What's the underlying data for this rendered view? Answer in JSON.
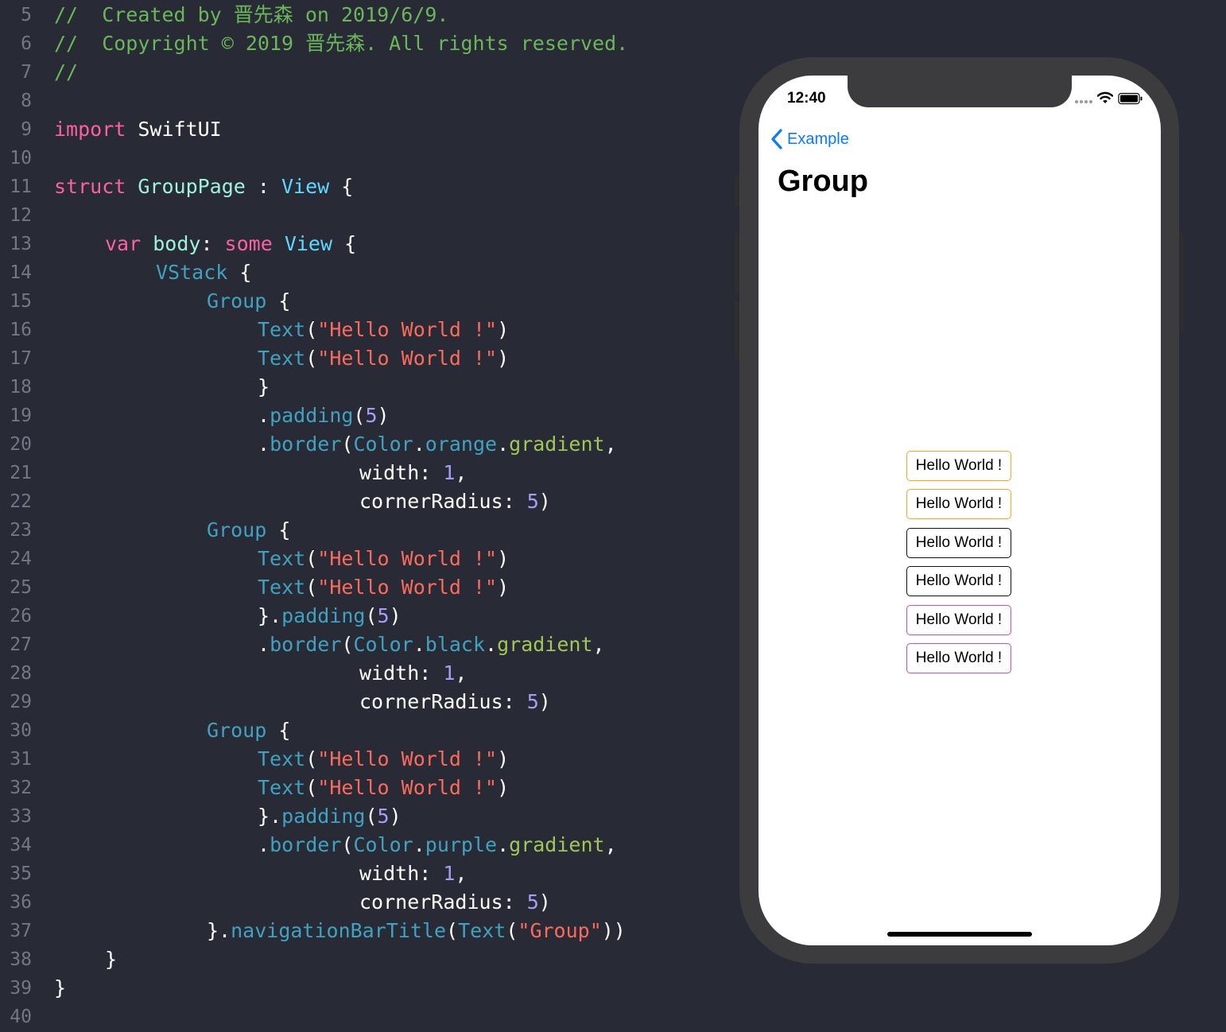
{
  "editor": {
    "lines": [
      {
        "num": "5",
        "indent": 0,
        "tokens": [
          {
            "t": "//  Created by 晋先森 on 2019/6/9.",
            "c": "com"
          }
        ]
      },
      {
        "num": "6",
        "indent": 0,
        "tokens": [
          {
            "t": "//  Copyright © 2019 晋先森. All rights reserved.",
            "c": "com"
          }
        ]
      },
      {
        "num": "7",
        "indent": 0,
        "tokens": [
          {
            "t": "//",
            "c": "com"
          }
        ]
      },
      {
        "num": "8",
        "indent": 0,
        "tokens": []
      },
      {
        "num": "9",
        "indent": 0,
        "tokens": [
          {
            "t": "import",
            "c": "kw"
          },
          {
            "t": " SwiftUI",
            "c": "plain"
          }
        ]
      },
      {
        "num": "10",
        "indent": 0,
        "tokens": []
      },
      {
        "num": "11",
        "indent": 0,
        "tokens": [
          {
            "t": "struct",
            "c": "kw"
          },
          {
            "t": " ",
            "c": "plain"
          },
          {
            "t": "GroupPage",
            "c": "custom"
          },
          {
            "t": " : ",
            "c": "plain"
          },
          {
            "t": "View",
            "c": "type"
          },
          {
            "t": " {",
            "c": "plain"
          }
        ]
      },
      {
        "num": "12",
        "indent": 0,
        "tokens": []
      },
      {
        "num": "13",
        "indent": 4,
        "tokens": [
          {
            "t": "var",
            "c": "kw"
          },
          {
            "t": " ",
            "c": "plain"
          },
          {
            "t": "body",
            "c": "custom"
          },
          {
            "t": ": ",
            "c": "plain"
          },
          {
            "t": "some",
            "c": "kw"
          },
          {
            "t": " ",
            "c": "plain"
          },
          {
            "t": "View",
            "c": "type"
          },
          {
            "t": " {",
            "c": "plain"
          }
        ]
      },
      {
        "num": "14",
        "indent": 8,
        "tokens": [
          {
            "t": "VStack",
            "c": "tp2"
          },
          {
            "t": " {",
            "c": "plain"
          }
        ]
      },
      {
        "num": "15",
        "indent": 12,
        "tokens": [
          {
            "t": "Group",
            "c": "tp2"
          },
          {
            "t": " {",
            "c": "plain"
          }
        ]
      },
      {
        "num": "16",
        "indent": 16,
        "tokens": [
          {
            "t": "Text",
            "c": "tp2"
          },
          {
            "t": "(",
            "c": "plain"
          },
          {
            "t": "\"Hello World !\"",
            "c": "str"
          },
          {
            "t": ")",
            "c": "plain"
          }
        ]
      },
      {
        "num": "17",
        "indent": 16,
        "tokens": [
          {
            "t": "Text",
            "c": "tp2"
          },
          {
            "t": "(",
            "c": "plain"
          },
          {
            "t": "\"Hello World !\"",
            "c": "str"
          },
          {
            "t": ")",
            "c": "plain"
          }
        ]
      },
      {
        "num": "18",
        "indent": 16,
        "tokens": [
          {
            "t": "}",
            "c": "plain"
          }
        ]
      },
      {
        "num": "19",
        "indent": 16,
        "tokens": [
          {
            "t": ".",
            "c": "plain"
          },
          {
            "t": "padding",
            "c": "mem"
          },
          {
            "t": "(",
            "c": "plain"
          },
          {
            "t": "5",
            "c": "num"
          },
          {
            "t": ")",
            "c": "plain"
          }
        ]
      },
      {
        "num": "20",
        "indent": 16,
        "tokens": [
          {
            "t": ".",
            "c": "plain"
          },
          {
            "t": "border",
            "c": "mem"
          },
          {
            "t": "(",
            "c": "plain"
          },
          {
            "t": "Color",
            "c": "tp2"
          },
          {
            "t": ".",
            "c": "plain"
          },
          {
            "t": "orange",
            "c": "mem"
          },
          {
            "t": ".",
            "c": "plain"
          },
          {
            "t": "gradient",
            "c": "prop"
          },
          {
            "t": ",",
            "c": "plain"
          }
        ]
      },
      {
        "num": "21",
        "indent": 24,
        "tokens": [
          {
            "t": "width: ",
            "c": "plain"
          },
          {
            "t": "1",
            "c": "num"
          },
          {
            "t": ",",
            "c": "plain"
          }
        ]
      },
      {
        "num": "22",
        "indent": 24,
        "tokens": [
          {
            "t": "cornerRadius: ",
            "c": "plain"
          },
          {
            "t": "5",
            "c": "num"
          },
          {
            "t": ")",
            "c": "plain"
          }
        ]
      },
      {
        "num": "23",
        "indent": 12,
        "tokens": [
          {
            "t": "Group",
            "c": "tp2"
          },
          {
            "t": " {",
            "c": "plain"
          }
        ]
      },
      {
        "num": "24",
        "indent": 16,
        "tokens": [
          {
            "t": "Text",
            "c": "tp2"
          },
          {
            "t": "(",
            "c": "plain"
          },
          {
            "t": "\"Hello World !\"",
            "c": "str"
          },
          {
            "t": ")",
            "c": "plain"
          }
        ]
      },
      {
        "num": "25",
        "indent": 16,
        "tokens": [
          {
            "t": "Text",
            "c": "tp2"
          },
          {
            "t": "(",
            "c": "plain"
          },
          {
            "t": "\"Hello World !\"",
            "c": "str"
          },
          {
            "t": ")",
            "c": "plain"
          }
        ]
      },
      {
        "num": "26",
        "indent": 16,
        "tokens": [
          {
            "t": "}.",
            "c": "plain"
          },
          {
            "t": "padding",
            "c": "mem"
          },
          {
            "t": "(",
            "c": "plain"
          },
          {
            "t": "5",
            "c": "num"
          },
          {
            "t": ")",
            "c": "plain"
          }
        ]
      },
      {
        "num": "27",
        "indent": 16,
        "tokens": [
          {
            "t": ".",
            "c": "plain"
          },
          {
            "t": "border",
            "c": "mem"
          },
          {
            "t": "(",
            "c": "plain"
          },
          {
            "t": "Color",
            "c": "tp2"
          },
          {
            "t": ".",
            "c": "plain"
          },
          {
            "t": "black",
            "c": "mem"
          },
          {
            "t": ".",
            "c": "plain"
          },
          {
            "t": "gradient",
            "c": "prop"
          },
          {
            "t": ",",
            "c": "plain"
          }
        ]
      },
      {
        "num": "28",
        "indent": 24,
        "tokens": [
          {
            "t": "width: ",
            "c": "plain"
          },
          {
            "t": "1",
            "c": "num"
          },
          {
            "t": ",",
            "c": "plain"
          }
        ]
      },
      {
        "num": "29",
        "indent": 24,
        "tokens": [
          {
            "t": "cornerRadius: ",
            "c": "plain"
          },
          {
            "t": "5",
            "c": "num"
          },
          {
            "t": ")",
            "c": "plain"
          }
        ]
      },
      {
        "num": "30",
        "indent": 12,
        "tokens": [
          {
            "t": "Group",
            "c": "tp2"
          },
          {
            "t": " {",
            "c": "plain"
          }
        ]
      },
      {
        "num": "31",
        "indent": 16,
        "tokens": [
          {
            "t": "Text",
            "c": "tp2"
          },
          {
            "t": "(",
            "c": "plain"
          },
          {
            "t": "\"Hello World !\"",
            "c": "str"
          },
          {
            "t": ")",
            "c": "plain"
          }
        ]
      },
      {
        "num": "32",
        "indent": 16,
        "tokens": [
          {
            "t": "Text",
            "c": "tp2"
          },
          {
            "t": "(",
            "c": "plain"
          },
          {
            "t": "\"Hello World !\"",
            "c": "str"
          },
          {
            "t": ")",
            "c": "plain"
          }
        ]
      },
      {
        "num": "33",
        "indent": 16,
        "tokens": [
          {
            "t": "}.",
            "c": "plain"
          },
          {
            "t": "padding",
            "c": "mem"
          },
          {
            "t": "(",
            "c": "plain"
          },
          {
            "t": "5",
            "c": "num"
          },
          {
            "t": ")",
            "c": "plain"
          }
        ]
      },
      {
        "num": "34",
        "indent": 16,
        "tokens": [
          {
            "t": ".",
            "c": "plain"
          },
          {
            "t": "border",
            "c": "mem"
          },
          {
            "t": "(",
            "c": "plain"
          },
          {
            "t": "Color",
            "c": "tp2"
          },
          {
            "t": ".",
            "c": "plain"
          },
          {
            "t": "purple",
            "c": "mem"
          },
          {
            "t": ".",
            "c": "plain"
          },
          {
            "t": "gradient",
            "c": "prop"
          },
          {
            "t": ",",
            "c": "plain"
          }
        ]
      },
      {
        "num": "35",
        "indent": 24,
        "tokens": [
          {
            "t": "width: ",
            "c": "plain"
          },
          {
            "t": "1",
            "c": "num"
          },
          {
            "t": ",",
            "c": "plain"
          }
        ]
      },
      {
        "num": "36",
        "indent": 24,
        "tokens": [
          {
            "t": "cornerRadius: ",
            "c": "plain"
          },
          {
            "t": "5",
            "c": "num"
          },
          {
            "t": ")",
            "c": "plain"
          }
        ]
      },
      {
        "num": "37",
        "indent": 12,
        "tokens": [
          {
            "t": "}.",
            "c": "plain"
          },
          {
            "t": "navigationBarTitle",
            "c": "mem"
          },
          {
            "t": "(",
            "c": "plain"
          },
          {
            "t": "Text",
            "c": "tp2"
          },
          {
            "t": "(",
            "c": "plain"
          },
          {
            "t": "\"Group\"",
            "c": "str"
          },
          {
            "t": "))",
            "c": "plain"
          }
        ]
      },
      {
        "num": "38",
        "indent": 4,
        "tokens": [
          {
            "t": "}",
            "c": "plain"
          }
        ]
      },
      {
        "num": "39",
        "indent": 0,
        "tokens": [
          {
            "t": "}",
            "c": "plain"
          }
        ]
      },
      {
        "num": "40",
        "indent": 0,
        "tokens": []
      }
    ]
  },
  "simulator": {
    "status_bar": {
      "time": "12:40",
      "icons": [
        "signal-icon",
        "wifi-icon",
        "battery-icon"
      ]
    },
    "nav": {
      "back_label": "Example",
      "back_icon": "chevron-left-icon",
      "title": "Group"
    },
    "texts": [
      {
        "label": "Hello World !",
        "border": "#f5a623"
      },
      {
        "label": "Hello World !",
        "border": "#f5a623"
      },
      {
        "label": "Hello World !",
        "border": "#111111"
      },
      {
        "label": "Hello World !",
        "border": "#111111"
      },
      {
        "label": "Hello World !",
        "border": "#c04fd0"
      },
      {
        "label": "Hello World !",
        "border": "#c04fd0"
      }
    ],
    "accent_color": "#0a7aff"
  }
}
